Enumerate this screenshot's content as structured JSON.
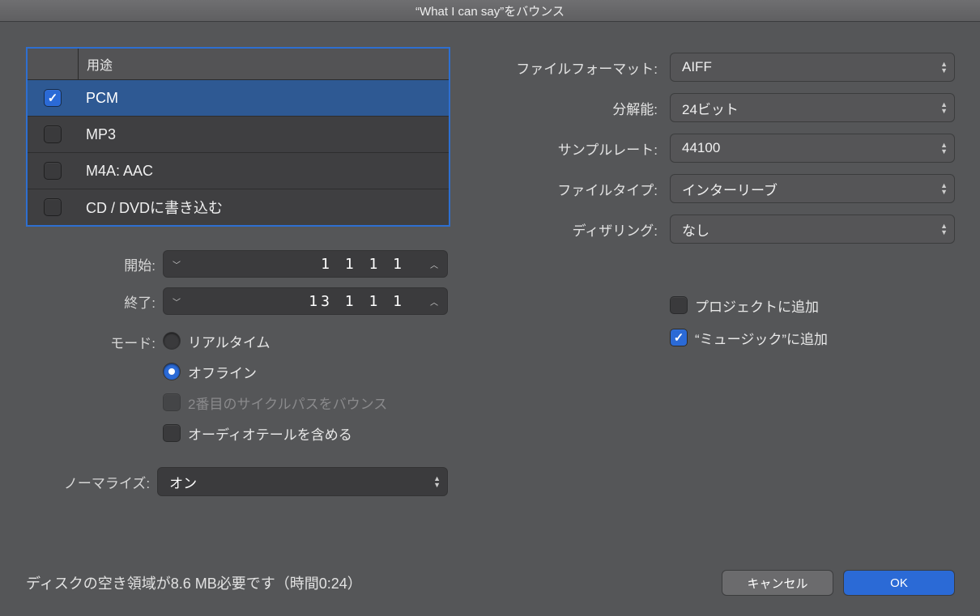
{
  "title": "“What I can say”をバウンス",
  "destTable": {
    "header": "用途",
    "rows": [
      {
        "label": "PCM",
        "checked": true,
        "selected": true
      },
      {
        "label": "MP3",
        "checked": false,
        "selected": false
      },
      {
        "label": "M4A: AAC",
        "checked": false,
        "selected": false
      },
      {
        "label": "CD / DVDに書き込む",
        "checked": false,
        "selected": false
      }
    ]
  },
  "left": {
    "startLabel": "開始:",
    "startValue": "1 1 1  1",
    "endLabel": "終了:",
    "endValue": "13 1 1  1",
    "modeLabel": "モード:",
    "modeRealtime": "リアルタイム",
    "modeOffline": "オフライン",
    "secondPass": "2番目のサイクルパスをバウンス",
    "includeTail": "オーディオテールを含める",
    "normalizeLabel": "ノーマライズ:",
    "normalizeValue": "オン"
  },
  "right": {
    "fileFormatLabel": "ファイルフォーマット:",
    "fileFormatValue": "AIFF",
    "resolutionLabel": "分解能:",
    "resolutionValue": "24ビット",
    "sampleRateLabel": "サンプルレート:",
    "sampleRateValue": "44100",
    "fileTypeLabel": "ファイルタイプ:",
    "fileTypeValue": "インターリーブ",
    "ditheringLabel": "ディザリング:",
    "ditheringValue": "なし",
    "addToProject": "プロジェクトに追加",
    "addToMusic": "“ミュージック”に追加"
  },
  "footer": {
    "status": "ディスクの空き領域が8.6 MB必要です（時間0:24）",
    "cancel": "キャンセル",
    "ok": "OK"
  }
}
